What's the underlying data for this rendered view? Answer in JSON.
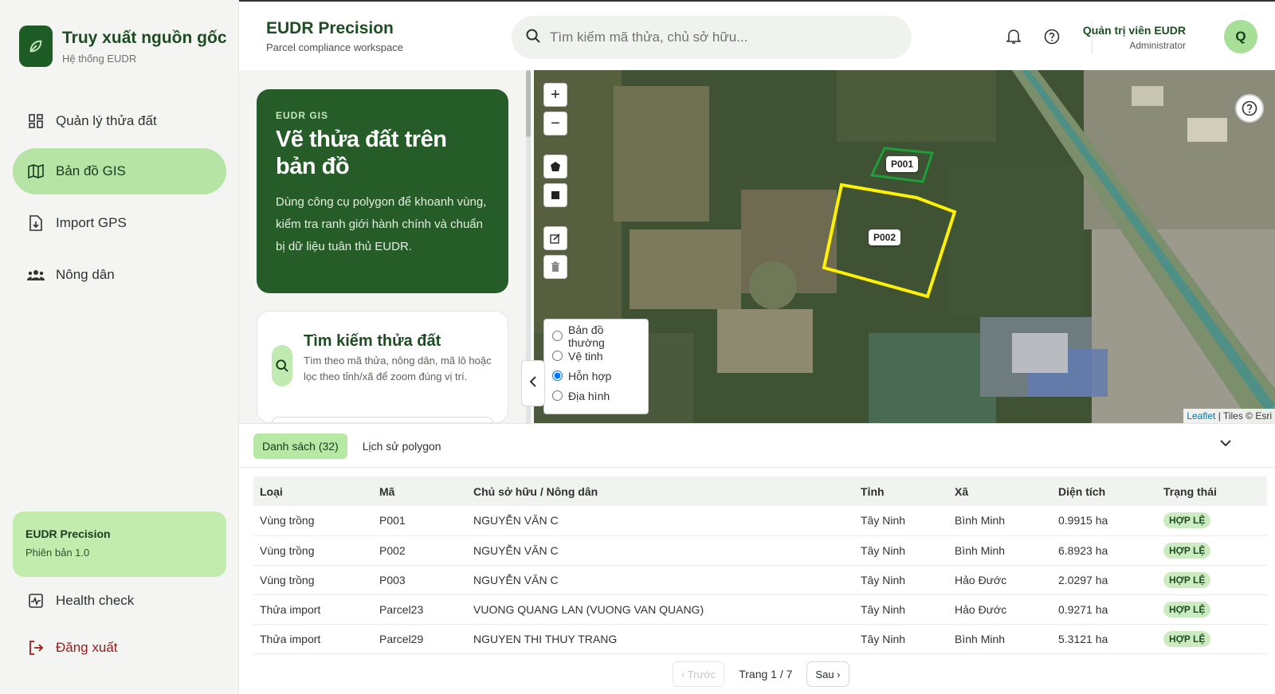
{
  "sidebar": {
    "brand_title": "Truy xuất nguồn gốc",
    "brand_sub": "Hệ thống EUDR",
    "nav": [
      {
        "label": "Quản lý thửa đất",
        "icon": "dashboard-icon"
      },
      {
        "label": "Bản đồ GIS",
        "icon": "map-icon",
        "active": true
      },
      {
        "label": "Import GPS",
        "icon": "file-import-icon"
      },
      {
        "label": "Nông dân",
        "icon": "users-icon"
      }
    ],
    "version_name": "EUDR Precision",
    "version_num": "Phiên bản 1.0",
    "health_check": "Health check",
    "logout": "Đăng xuất"
  },
  "header": {
    "title": "EUDR Precision",
    "subtitle": "Parcel compliance workspace",
    "search_placeholder": "Tìm kiếm mã thửa, chủ sở hữu...",
    "user_name": "Quản trị viên EUDR",
    "user_role": "Administrator",
    "avatar_initial": "Q"
  },
  "hero": {
    "eyebrow": "EUDR GIS",
    "title": "Vẽ thửa đất trên bản đồ",
    "description": "Dùng công cụ polygon để khoanh vùng, kiểm tra ranh giới hành chính và chuẩn bị dữ liệu tuân thủ EUDR."
  },
  "search_card": {
    "title": "Tìm kiếm thửa đất",
    "description": "Tìm theo mã thửa, nông dân, mã lô hoặc lọc theo tỉnh/xã để zoom đúng vị trí."
  },
  "map": {
    "zoom_in": "+",
    "zoom_out": "−",
    "layers": [
      "Bản đồ thường",
      "Vệ tinh",
      "Hỗn hợp",
      "Địa hình"
    ],
    "selected_layer": "Hỗn hợp",
    "parcel_labels": [
      "P001",
      "P002"
    ],
    "attribution_leaflet": "Leaflet",
    "attribution_tiles": "| Tiles © Esri",
    "colors": {
      "p001": "#1f9e3a",
      "p002": "#fff200"
    }
  },
  "bottom": {
    "tab_list": "Danh sách (32)",
    "tab_history": "Lịch sử polygon",
    "columns": [
      "Loại",
      "Mã",
      "Chủ sở hữu / Nông dân",
      "Tỉnh",
      "Xã",
      "Diện tích",
      "Trạng thái"
    ],
    "rows": [
      [
        "Vùng trồng",
        "P001",
        "NGUYỄN VĂN C",
        "Tây Ninh",
        "Bình Minh",
        "0.9915 ha",
        "HỢP LỆ"
      ],
      [
        "Vùng trồng",
        "P002",
        "NGUYỄN VĂN C",
        "Tây Ninh",
        "Bình Minh",
        "6.8923 ha",
        "HỢP LỆ"
      ],
      [
        "Vùng trồng",
        "P003",
        "NGUYỄN VĂN C",
        "Tây Ninh",
        "Hảo Đước",
        "2.0297 ha",
        "HỢP LỆ"
      ],
      [
        "Thửa import",
        "Parcel23",
        "VUONG QUANG LAN (VUONG VAN QUANG)",
        "Tây Ninh",
        "Hảo Đước",
        "0.9271 ha",
        "HỢP LỆ"
      ],
      [
        "Thửa import",
        "Parcel29",
        "NGUYEN THI THUY TRANG",
        "Tây Ninh",
        "Bình Minh",
        "5.3121 ha",
        "HỢP LỆ"
      ]
    ],
    "prev": "‹ Trước",
    "page": "Trang 1 / 7",
    "next": "Sau ›"
  }
}
